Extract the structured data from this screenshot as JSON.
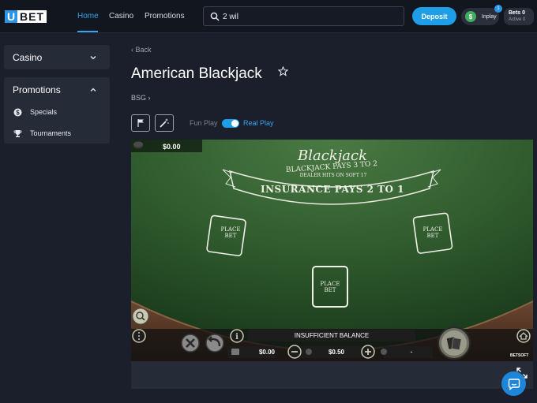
{
  "header": {
    "logo_letter": "U",
    "logo_rest": "BET",
    "nav": [
      {
        "label": "Home",
        "active": true
      },
      {
        "label": "Casino",
        "active": false
      },
      {
        "label": "Promotions",
        "active": false
      }
    ],
    "search_value": "2 wil",
    "deposit_label": "Deposit",
    "inplay_label": "Inplay",
    "inplay_badge": "1",
    "bets_label": "Bets 0",
    "bets_sub": "Active 0",
    "accent_color": "#35a4f0"
  },
  "sidebar": {
    "casino_label": "Casino",
    "promotions_label": "Promotions",
    "promo_items": [
      {
        "label": "Specials",
        "icon": "dollar-circle-icon"
      },
      {
        "label": "Tournaments",
        "icon": "trophy-icon"
      }
    ]
  },
  "main": {
    "back_label": "Back",
    "title": "American Blackjack",
    "provider": "BSG",
    "fun_play_label": "Fun Play",
    "real_play_label": "Real Play",
    "real_play_on": true
  },
  "game": {
    "balance_top": "$0.00",
    "table_title": "Blackjack",
    "rule_line1": "BLACKJACK PAYS 3 TO 2",
    "rule_line2": "DEALER HITS ON SOFT 17",
    "insurance": "INSURANCE PAYS 2 TO 1",
    "spot_line1": "PLACE",
    "spot_line2": "BET",
    "status": "INSUFFICIENT BALANCE",
    "balance_bottom": "$0.00",
    "bet_amount": "$0.50",
    "side_value": "-",
    "brand": "BETSOFT"
  }
}
